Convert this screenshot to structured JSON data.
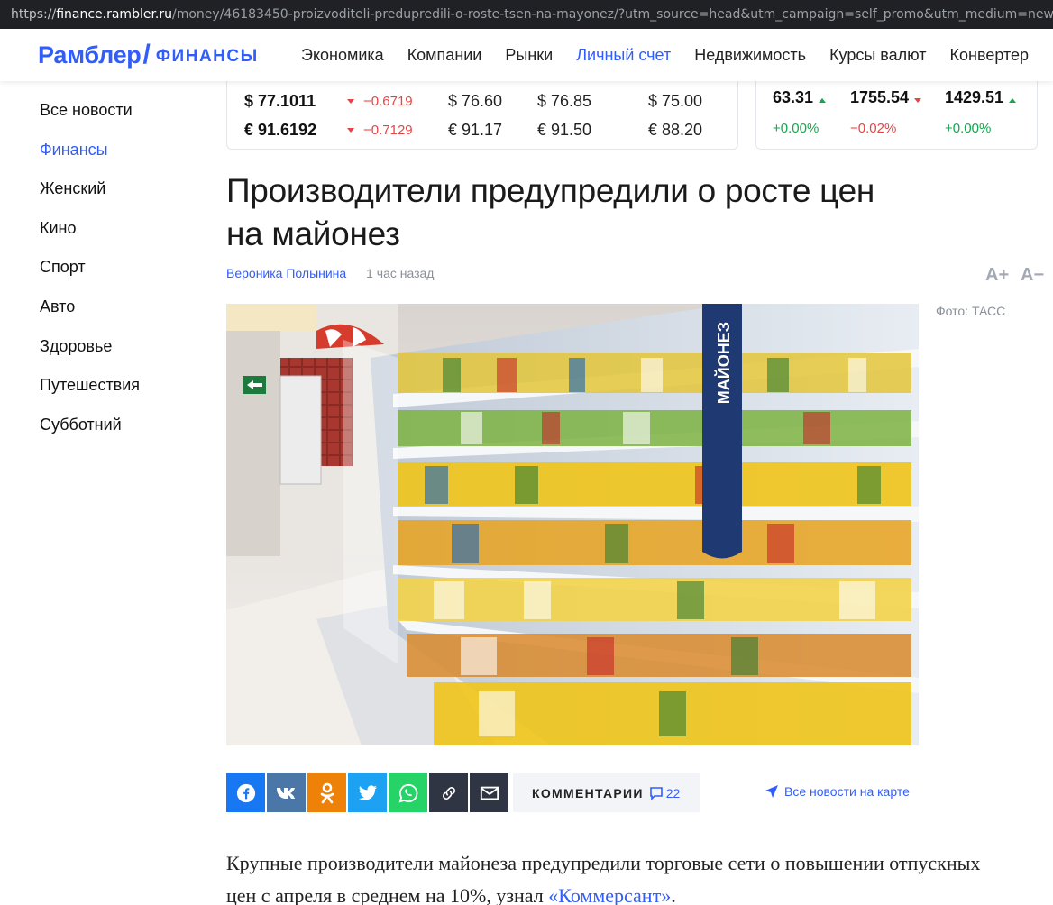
{
  "browser": {
    "url_proto": "https://",
    "url_host": "finance.rambler.ru",
    "url_path": "/money/46183450-proizvoditeli-predupredili-o-roste-tsen-na-mayonez/?utm_source=head&utm_campaign=self_promo&utm_medium=news&utm_content=news"
  },
  "header": {
    "logo_main": "Рамблер",
    "logo_slash": "/",
    "logo_section": "ФИНАНСЫ",
    "nav": [
      "Экономика",
      "Компании",
      "Рынки",
      "Личный счет",
      "Недвижимость",
      "Курсы валют",
      "Конвертер"
    ],
    "nav_active": "Личный счет"
  },
  "sidebar": {
    "items": [
      "Все новости",
      "Финансы",
      "Женский",
      "Кино",
      "Спорт",
      "Авто",
      "Здоровье",
      "Путешествия",
      "Субботний"
    ],
    "active": "Финансы"
  },
  "rates": {
    "usd": {
      "main": "$ 77.1011",
      "change": "−0.6719",
      "col1": "$ 76.60",
      "col2": "$ 76.85",
      "col3": "$ 75.00"
    },
    "eur": {
      "main": "€ 91.6192",
      "change": "−0.7129",
      "col1": "€ 91.17",
      "col2": "€ 91.50",
      "col3": "€ 88.20"
    }
  },
  "indices": [
    {
      "value": "63.31",
      "change": "+0.00%",
      "direction": "up"
    },
    {
      "value": "1755.54",
      "change": "−0.02%",
      "direction": "down"
    },
    {
      "value": "1429.51",
      "change": "+0.00%",
      "direction": "up"
    }
  ],
  "article": {
    "title": "Производители предупредили о росте цен на майонез",
    "author": "Вероника Полынина",
    "time": "1 час назад",
    "font_plus": "A+",
    "font_minus": "A−",
    "photo_credit": "Фото: ТАСС",
    "photo_shelf_sign": "МАЙОНЕЗ",
    "comments_label": "КОММЕНТАРИИ",
    "comments_count": "22",
    "map_link": "Все новости на карте",
    "lead_text": "Крупные производители майонеза предупредили торговые сети о повышении отпускных цен с апреля в среднем на 10%, узнал ",
    "lead_link": "«Коммерсант»",
    "lead_end": "."
  },
  "share_icons": [
    "facebook-icon",
    "vk-icon",
    "odnoklassniki-icon",
    "twitter-icon",
    "whatsapp-icon",
    "copy-link-icon",
    "email-icon"
  ],
  "colors": {
    "accent": "#315efb",
    "down": "#e54545",
    "up": "#13a84f",
    "facebook": "#1877f2",
    "vk": "#4a76a8",
    "ok": "#ee8208",
    "twitter": "#1da1f2",
    "whatsapp": "#25d366",
    "link": "#2f3542"
  }
}
